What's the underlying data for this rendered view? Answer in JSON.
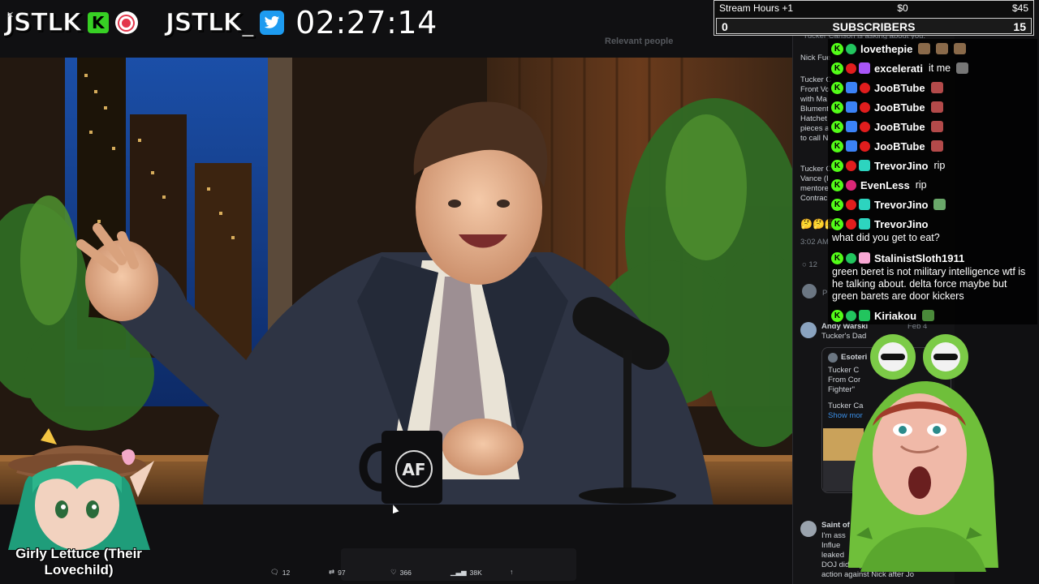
{
  "overlay": {
    "brand_kick": "JSTLK",
    "kick_letter": "K",
    "brand_twitter": "JSTLK_",
    "timer": "02:27:14"
  },
  "hours_bar": {
    "title": "Stream Hours +1",
    "money_mid": "$0",
    "money_right": "$45",
    "count_left": "0",
    "label": "SUBSCRIBERS",
    "count_right": "15"
  },
  "chat": {
    "messages": [
      {
        "user": "lovethepie",
        "text": "",
        "pill": "#22c55e",
        "badge": "none"
      },
      {
        "user": "excelerati",
        "text": "it me",
        "pill": "#e11d1d",
        "badge": "#a855f7"
      },
      {
        "user": "JooBTube",
        "text": "",
        "pill": "#e11d1d",
        "badge": "#3b82f6"
      },
      {
        "user": "JooBTube",
        "text": "",
        "pill": "#e11d1d",
        "badge": "#3b82f6"
      },
      {
        "user": "JooBTube",
        "text": "",
        "pill": "#e11d1d",
        "badge": "#3b82f6"
      },
      {
        "user": "JooBTube",
        "text": "",
        "pill": "#e11d1d",
        "badge": "#3b82f6"
      },
      {
        "user": "TrevorJino",
        "text": "rip",
        "pill": "#e11d1d",
        "badge": "#2dd4bf"
      },
      {
        "user": "EvenLess",
        "text": "rip",
        "pill": "#db2777",
        "badge": "none"
      },
      {
        "user": "TrevorJino",
        "text": "",
        "pill": "#e11d1d",
        "badge": "#2dd4bf"
      },
      {
        "user": "TrevorJino",
        "text": "what did you get to eat?",
        "pill": "#e11d1d",
        "badge": "#2dd4bf"
      },
      {
        "user": "StalinistSloth1911",
        "text": "green beret is not military intelligence wtf is he talking about. delta force maybe but green barets are door kickers",
        "pill": "#22c55e",
        "badge": "#f9a8d4"
      },
      {
        "user": "Kiriakou",
        "text": "",
        "pill": "#22c55e",
        "badge": "#22c55e"
      }
    ]
  },
  "twitter_bg": {
    "quote_line": "\"Tucker Carlson is asking about you.\"",
    "nick_line": "Nick Fue",
    "para1": [
      "Tucker C",
      "Front Vo",
      "with Ma",
      "Blument",
      "Hatchet",
      "pieces a",
      "to call N"
    ],
    "para2": [
      "Tucker C",
      "Vance (I",
      "mentore",
      "Contrac"
    ],
    "time": "3:02 AM",
    "reply_count": "12",
    "relevant": "Relevant people",
    "andy_name": "Andy Warski",
    "andy_sub": "Tucker's Dad",
    "andy_date": "Feb 4",
    "esoteric_name": "Esoteri",
    "esoteric_lines": [
      "Tucker C",
      "From Cor",
      "Fighter\""
    ],
    "esoteric_line4": "Tucker Ca",
    "show_more": "Show mor",
    "saint_name": "Saint of",
    "saint_lines": [
      "I'm ass",
      "Influe",
      "leaked",
      "DOJ didn't p",
      "action against Nick after Jo"
    ],
    "actions": {
      "replies": "12",
      "reposts": "97",
      "likes": "366",
      "views": "38K"
    }
  },
  "avatars": {
    "lettuce_label": "Girly Lettuce (Their Lovechild)"
  },
  "colors": {
    "kick_green": "#53fc18",
    "twitter_blue": "#1d9bf0",
    "rec_red": "#e3364b"
  }
}
